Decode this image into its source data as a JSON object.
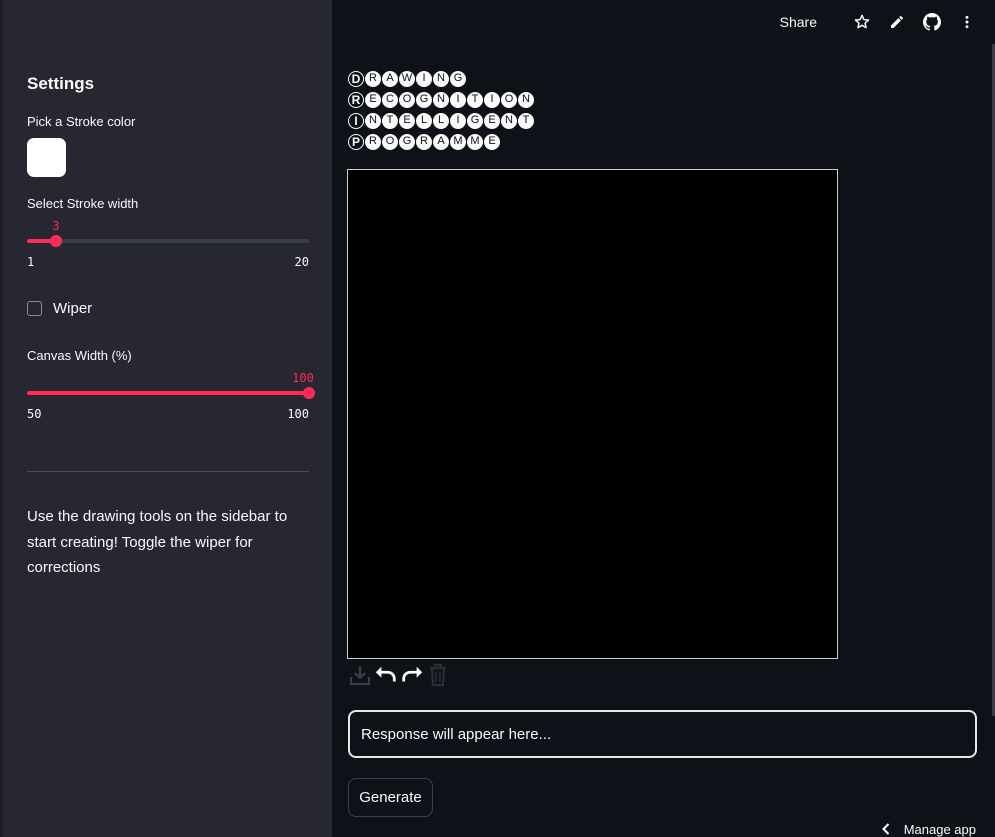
{
  "sidebar": {
    "title": "Settings",
    "stroke_color_label": "Pick a Stroke color",
    "stroke_color": "#ffffff",
    "stroke_width": {
      "label": "Select Stroke width",
      "value": "3",
      "min": "1",
      "max": "20"
    },
    "wiper": {
      "label": "Wiper",
      "checked": false
    },
    "canvas_width": {
      "label": "Canvas Width (%)",
      "value": "100",
      "min": "50",
      "max": "100"
    },
    "info_text": "Use the drawing tools on the sidebar to start creating! Toggle the wiper for corrections"
  },
  "toolbar": {
    "share_label": "Share",
    "icons": [
      "star-icon",
      "pencil-icon",
      "github-icon",
      "more-vertical-icon"
    ]
  },
  "title_lines": [
    {
      "first": "D",
      "rest": [
        "R",
        "A",
        "W",
        "I",
        "N",
        "G"
      ]
    },
    {
      "first": "R",
      "rest": [
        "E",
        "C",
        "O",
        "G",
        "N",
        "I",
        "T",
        "I",
        "O",
        "N"
      ]
    },
    {
      "first": "I",
      "rest": [
        "N",
        "T",
        "E",
        "L",
        "L",
        "I",
        "G",
        "E",
        "N",
        "T"
      ]
    },
    {
      "first": "P",
      "rest": [
        "R",
        "O",
        "G",
        "R",
        "A",
        "M",
        "M",
        "E"
      ]
    }
  ],
  "canvas_tools": [
    "download-icon",
    "undo-icon",
    "redo-icon",
    "trash-icon"
  ],
  "response": {
    "placeholder": "Response will appear here..."
  },
  "generate_label": "Generate",
  "manage_app_label": "Manage app",
  "colors": {
    "accent": "#ff2b56",
    "background": "#0e1117",
    "sidebar": "#262730"
  }
}
